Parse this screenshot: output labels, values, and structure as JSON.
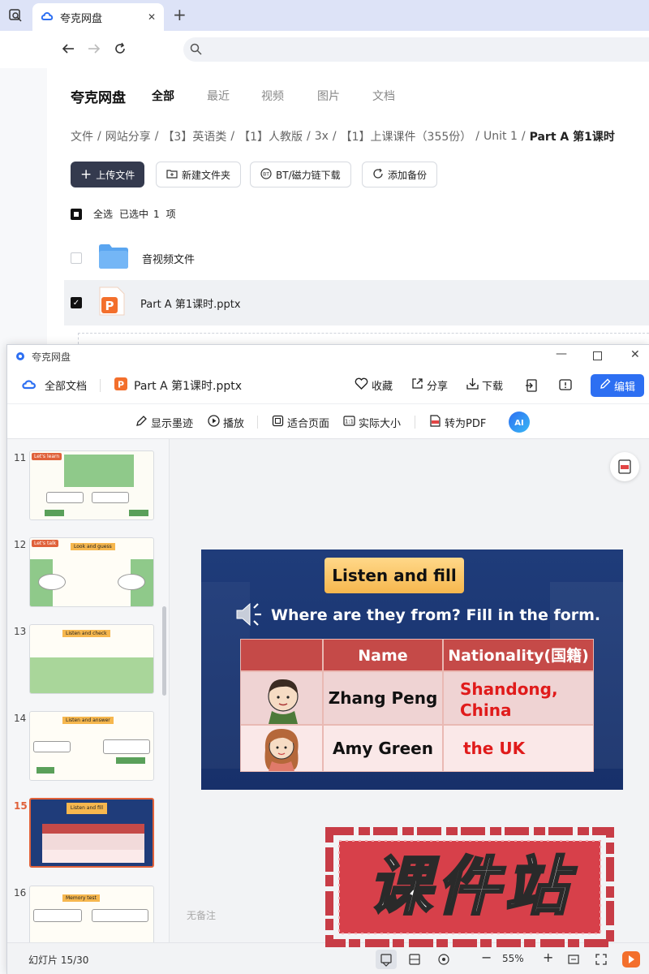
{
  "browser": {
    "tab_title": "夸克网盘",
    "close_glyph": "✕",
    "new_tab_glyph": "+"
  },
  "drive": {
    "brand": "夸克网盘",
    "nav_tabs": [
      "全部",
      "最近",
      "视频",
      "图片",
      "文档"
    ],
    "active_tab": "全部",
    "breadcrumb": [
      "文件",
      "网站分享",
      "【3】英语类",
      "【1】人教版",
      "3x",
      "【1】上课课件（355份）",
      "Unit 1",
      "Part A 第1课时"
    ],
    "actions": {
      "upload": "上传文件",
      "new_folder": "新建文件夹",
      "bt_download": "BT/磁力链下载",
      "add_backup": "添加备份"
    },
    "select_all": "全选",
    "selected_text": "已选中",
    "selected_count": "1",
    "selected_unit": "项",
    "files": [
      {
        "name": "音视频文件",
        "type": "folder",
        "checked": false
      },
      {
        "name": "Part  A 第1课时.pptx",
        "type": "pptx",
        "checked": true
      }
    ]
  },
  "viewer": {
    "window_title": "夸克网盘",
    "all_docs": "全部文档",
    "file_name": "Part A 第1课时.pptx",
    "actions": {
      "favorite": "收藏",
      "share": "分享",
      "download": "下载",
      "edit": "编辑"
    },
    "subtoolbar": {
      "show_ink": "显示墨迹",
      "play": "播放",
      "fit_page": "适合页面",
      "actual_size": "实际大小",
      "to_pdf": "转为PDF"
    },
    "thumb_numbers": [
      "11",
      "12",
      "13",
      "14",
      "15",
      "16"
    ],
    "selected_slide": "15",
    "thumb_texts": {
      "t11_tag": "Let's learn",
      "t12_tag": "Let's talk",
      "t12_banner": "Look and guess",
      "t13_banner": "Listen and check",
      "t14_banner": "Listen and answer",
      "t15_banner": "Listen and fill",
      "t16_banner": "Memory test"
    },
    "notes_placeholder": "无备注",
    "status": "幻灯片 15/30",
    "zoom": "55%"
  },
  "slide": {
    "title": "Listen and fill",
    "question": "Where are they from? Fill in the form.",
    "headers": [
      "Name",
      "Nationality(国籍)"
    ],
    "rows": [
      {
        "name": "Zhang Peng",
        "nationality": [
          "Shandong,",
          "China"
        ]
      },
      {
        "name": "Amy Green",
        "nationality": [
          "the UK"
        ]
      }
    ]
  },
  "watermark": {
    "text": "课件站"
  },
  "colors": {
    "accent": "#2d6ff2",
    "dark_button": "#343a4e",
    "slide_bg": "#1f3c7a",
    "table_header": "#c54a48",
    "answer_red": "#e01b1b"
  }
}
